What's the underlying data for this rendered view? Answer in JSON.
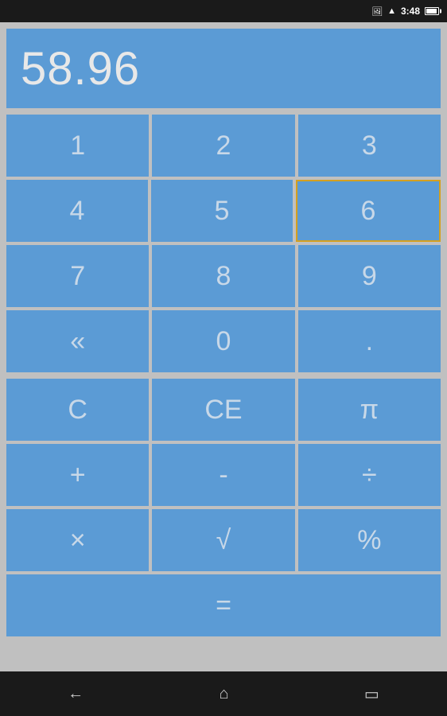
{
  "statusBar": {
    "time": "3:48",
    "wifiIcon": "wifi",
    "batteryIcon": "battery"
  },
  "display": {
    "value": "58.96"
  },
  "numpad": {
    "rows": [
      [
        {
          "label": "1",
          "name": "btn-1"
        },
        {
          "label": "2",
          "name": "btn-2"
        },
        {
          "label": "3",
          "name": "btn-3",
          "highlight": false
        }
      ],
      [
        {
          "label": "4",
          "name": "btn-4"
        },
        {
          "label": "5",
          "name": "btn-5"
        },
        {
          "label": "6",
          "name": "btn-6",
          "highlight": true
        }
      ],
      [
        {
          "label": "7",
          "name": "btn-7"
        },
        {
          "label": "8",
          "name": "btn-8"
        },
        {
          "label": "9",
          "name": "btn-9"
        }
      ],
      [
        {
          "label": "«",
          "name": "btn-backspace"
        },
        {
          "label": "0",
          "name": "btn-0"
        },
        {
          "label": ".",
          "name": "btn-dot"
        }
      ]
    ]
  },
  "operations": {
    "rows": [
      [
        {
          "label": "C",
          "name": "btn-clear"
        },
        {
          "label": "CE",
          "name": "btn-ce"
        },
        {
          "label": "π",
          "name": "btn-pi"
        }
      ],
      [
        {
          "label": "+",
          "name": "btn-plus"
        },
        {
          "label": "-",
          "name": "btn-minus"
        },
        {
          "label": "÷",
          "name": "btn-divide"
        }
      ],
      [
        {
          "label": "×",
          "name": "btn-multiply"
        },
        {
          "label": "√",
          "name": "btn-sqrt"
        },
        {
          "label": "%",
          "name": "btn-percent"
        }
      ],
      [
        {
          "label": "=",
          "name": "btn-equals",
          "wide": true
        }
      ]
    ]
  },
  "navBar": {
    "backLabel": "←",
    "homeLabel": "⌂",
    "recentLabel": "▭"
  }
}
